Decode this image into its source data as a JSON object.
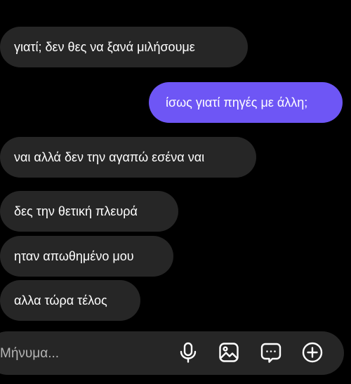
{
  "messages": [
    {
      "text": "γιατί; δεν θες να ξανά μιλήσουμε",
      "direction": "incoming"
    },
    {
      "text": "ίσως γιατί πηγές με άλλη;",
      "direction": "outgoing"
    },
    {
      "text": "ναι αλλά δεν την αγαπώ εσένα ναι",
      "direction": "incoming"
    },
    {
      "text": "δες την θετική πλευρά",
      "direction": "incoming"
    },
    {
      "text": "ηταν απωθημένο  μου",
      "direction": "incoming"
    },
    {
      "text": "αλλα τώρα τέλος",
      "direction": "incoming"
    }
  ],
  "composer": {
    "placeholder": "Μήνυμα...",
    "icons": [
      "microphone-icon",
      "image-icon",
      "chat-more-icon",
      "add-icon"
    ]
  },
  "colors": {
    "background": "#000000",
    "incoming_bubble": "#262626",
    "outgoing_bubble": "#6e56f5",
    "text": "#ffffff"
  }
}
